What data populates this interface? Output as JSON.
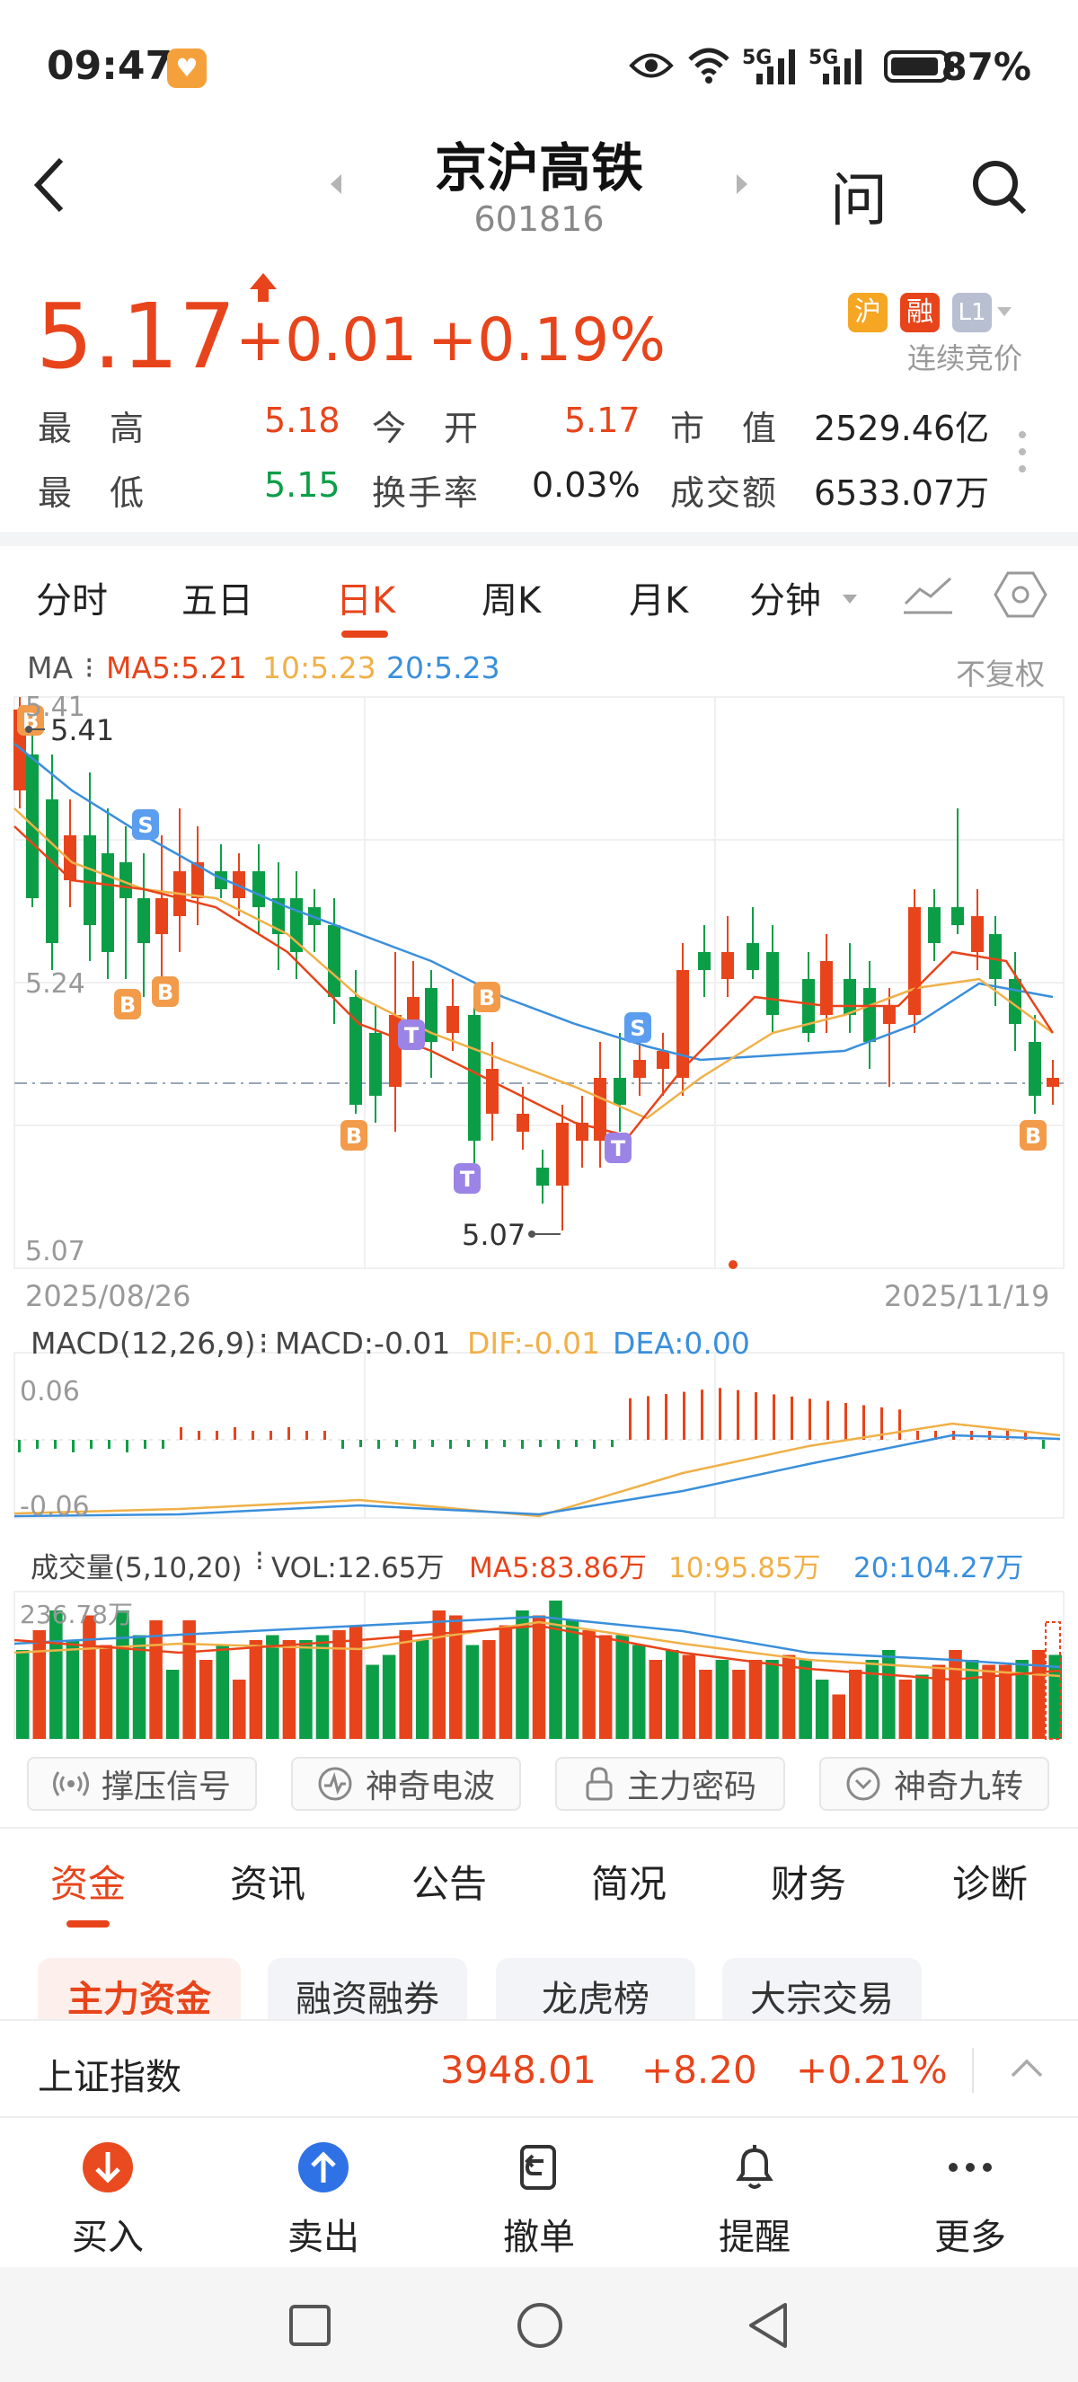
{
  "status_bar": {
    "time": "09:47",
    "battery": "87%",
    "net1": "5G",
    "net2": "5G"
  },
  "header": {
    "title": "京沪高铁",
    "code": "601816",
    "ask_label": "问"
  },
  "quote": {
    "price": "5.17",
    "change": "+0.01",
    "change_pct": "+0.19%",
    "badges": [
      "沪",
      "融",
      "L1"
    ],
    "session": "连续竞价",
    "high_label": "最　高",
    "high": "5.18",
    "low_label": "最　低",
    "low": "5.15",
    "open_label": "今　开",
    "open": "5.17",
    "turnover_label": "换手率",
    "turnover": "0.03%",
    "mcap_label": "市　值",
    "mcap": "2529.46亿",
    "amount_label": "成交额",
    "amount": "6533.07万"
  },
  "period_tabs": [
    "分时",
    "五日",
    "日K",
    "周K",
    "月K",
    "分钟"
  ],
  "active_period": 2,
  "ma_bar": {
    "label": "MA",
    "ma5": "MA5:5.21",
    "ma10": "10:5.23",
    "ma20": "20:5.23",
    "adjust": "不复权"
  },
  "kline": {
    "y_top": "5.41",
    "y_mid": "5.24",
    "y_bottom": "5.07",
    "max_label": "5.41",
    "min_label": "5.07",
    "date_start": "2025/08/26",
    "date_end": "2025/11/19"
  },
  "macd": {
    "label": "MACD(12,26,9)",
    "macd": "MACD:-0.01",
    "dif": "DIF:-0.01",
    "dea": "DEA:0.00",
    "y_top": "0.06",
    "y_bottom": "-0.06"
  },
  "volume": {
    "label": "成交量(5,10,20)",
    "vol": "VOL:12.65万",
    "ma5": "MA5:83.86万",
    "ma10": "10:95.85万",
    "ma20": "20:104.27万",
    "y_top": "236.78万"
  },
  "indicator_buttons": [
    "撑压信号",
    "神奇电波",
    "主力密码",
    "神奇九转"
  ],
  "info_tabs": [
    "资金",
    "资讯",
    "公告",
    "简况",
    "财务",
    "诊断"
  ],
  "sub_tabs": [
    "主力资金",
    "融资融券",
    "龙虎榜",
    "大宗交易"
  ],
  "index_bar": {
    "name": "上证指数",
    "value": "3948.01",
    "change": "+8.20",
    "pct": "+0.21%"
  },
  "bottom_nav": [
    "买入",
    "卖出",
    "撤单",
    "提醒",
    "更多"
  ],
  "colors": {
    "up": "#e8441b",
    "down": "#0c9e47",
    "ma5": "#e8441b",
    "ma10": "#f0b048",
    "ma20": "#3a8fdb"
  }
}
